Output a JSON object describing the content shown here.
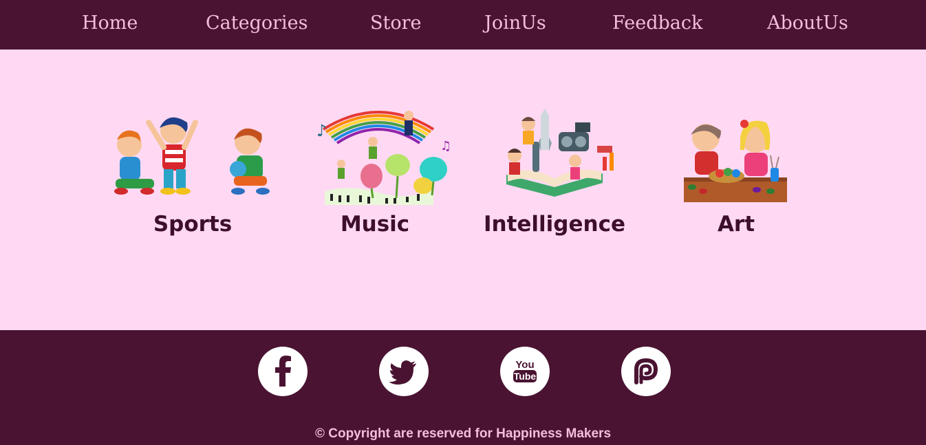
{
  "nav": {
    "items": [
      {
        "label": "Home"
      },
      {
        "label": "Categories"
      },
      {
        "label": "Store"
      },
      {
        "label": "JoinUs"
      },
      {
        "label": "Feedback"
      },
      {
        "label": "AboutUs"
      }
    ]
  },
  "categories": [
    {
      "label": "Sports",
      "icon": "sports-kids-image"
    },
    {
      "label": "Music",
      "icon": "music-rainbow-image"
    },
    {
      "label": "Intelligence",
      "icon": "science-book-image"
    },
    {
      "label": "Art",
      "icon": "painting-kids-image"
    }
  ],
  "footer": {
    "social": [
      {
        "name": "facebook-icon"
      },
      {
        "name": "twitter-icon"
      },
      {
        "name": "youtube-icon",
        "text": "You Tube"
      },
      {
        "name": "patreon-icon"
      }
    ],
    "copyright": "© Copyright are reserved for Happiness Makers"
  },
  "colors": {
    "nav_bg": "#4a1332",
    "nav_text": "#f4bfd9",
    "page_bg": "#ffd9f3",
    "category_text": "#3d0f2a",
    "footer_bg": "#4a1332"
  }
}
